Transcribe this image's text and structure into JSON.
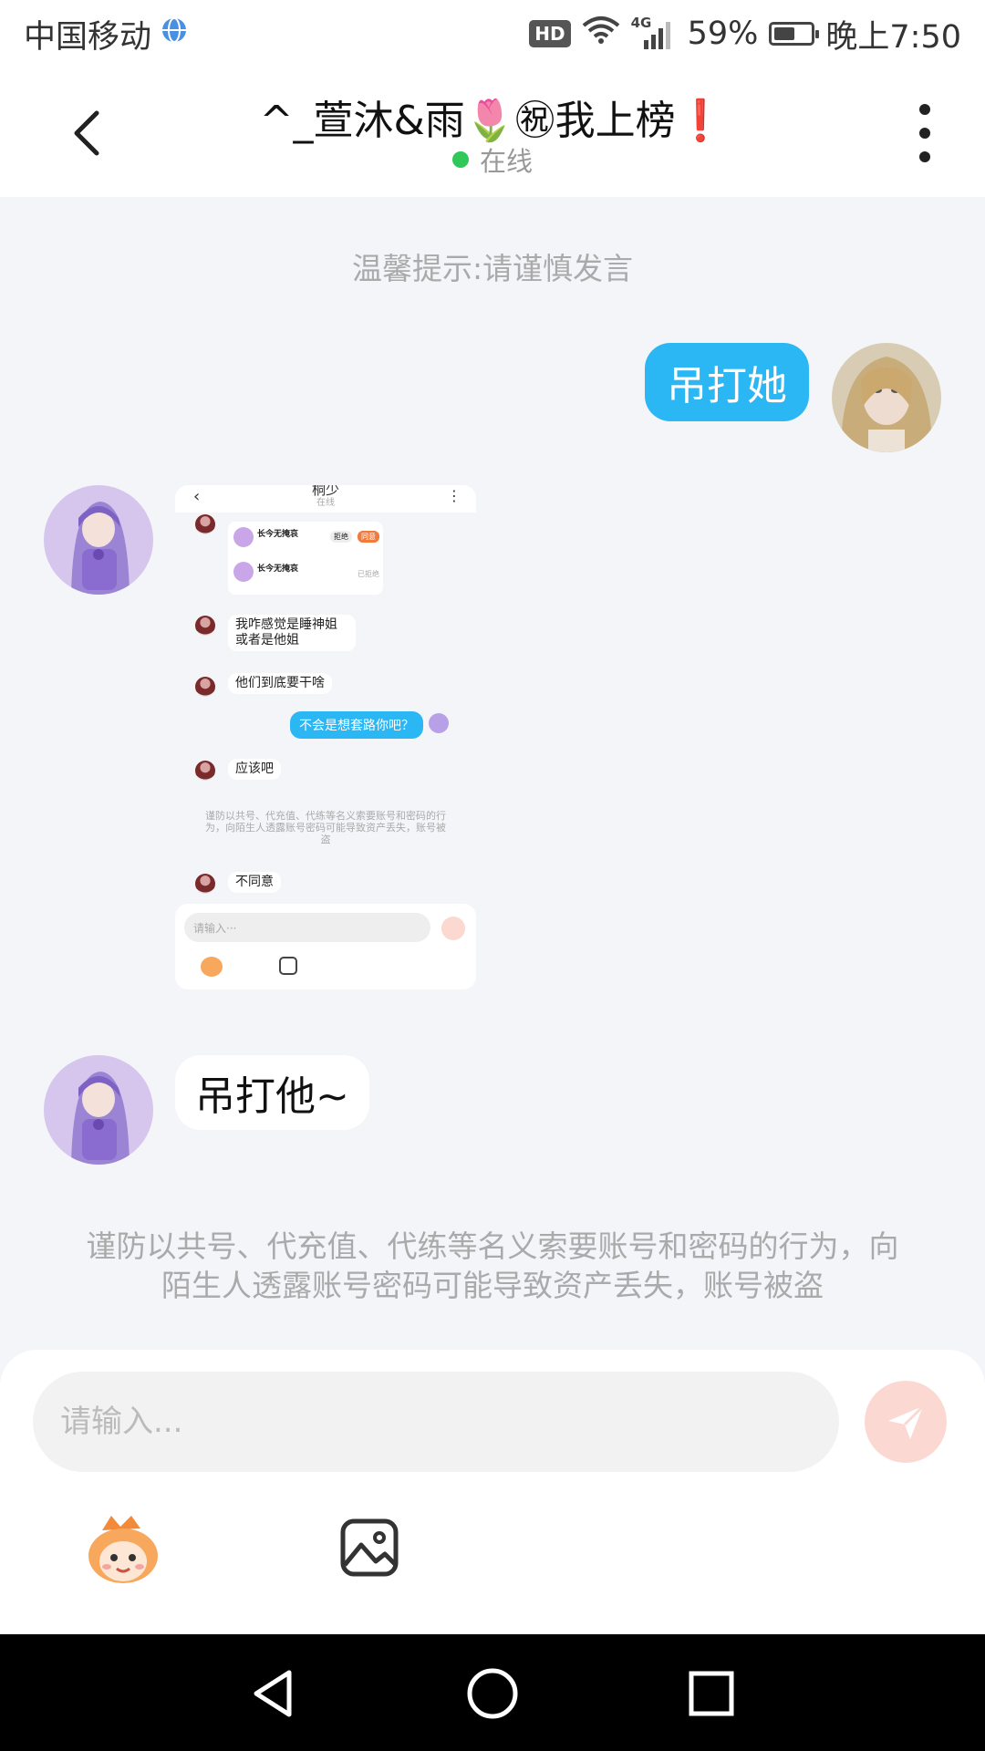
{
  "status_bar": {
    "carrier": "中国移动",
    "hd_badge": "HD",
    "network": "4G",
    "battery": "59%",
    "battery_level": 0.59,
    "time": "晚上7:50"
  },
  "header": {
    "title": "^_萱沐&雨🌷㊗我上榜❗",
    "status": "在线"
  },
  "messages": {
    "tip_top": "温馨提示:请谨慎发言",
    "sent_1": "吊打她",
    "received_2": "吊打他~",
    "warning": "谨防以共号、代充值、代练等名义索要账号和密码的行为，向陌生人透露账号密码可能导致资产丢失，账号被盗"
  },
  "screenshot": {
    "title": "桐少",
    "status": "在线",
    "card_1_name": "长今无掩哀",
    "card_1_btn_a": "拒绝",
    "card_1_btn_b": "同意",
    "card_2_name": "长今无掩哀",
    "card_2_status": "已拒绝",
    "msg_1": "我咋感觉是睡神姐或者是他姐",
    "msg_2": "他们到底要干啥",
    "sent": "不会是想套路你吧？",
    "msg_3": "应该吧",
    "warning": "谨防以共号、代充值、代练等名义索要账号和密码的行为，向陌生人透露账号密码可能导致资产丢失，账号被盗",
    "msg_4": "不同意",
    "input_placeholder": "请输入···"
  },
  "input": {
    "placeholder": "请输入..."
  },
  "icons": {
    "back": "chevron-left-icon",
    "more": "more-vertical-icon",
    "send": "send-icon",
    "emoji": "emoji-face-icon",
    "image": "image-icon",
    "nav_back": "triangle-back-icon",
    "nav_home": "circle-home-icon",
    "nav_recent": "square-recent-icon"
  },
  "colors": {
    "sent_bubble": "#2bb6f4",
    "online_dot": "#31c85a",
    "send_button": "#fbd9d2",
    "nav_bar": "#000000"
  }
}
